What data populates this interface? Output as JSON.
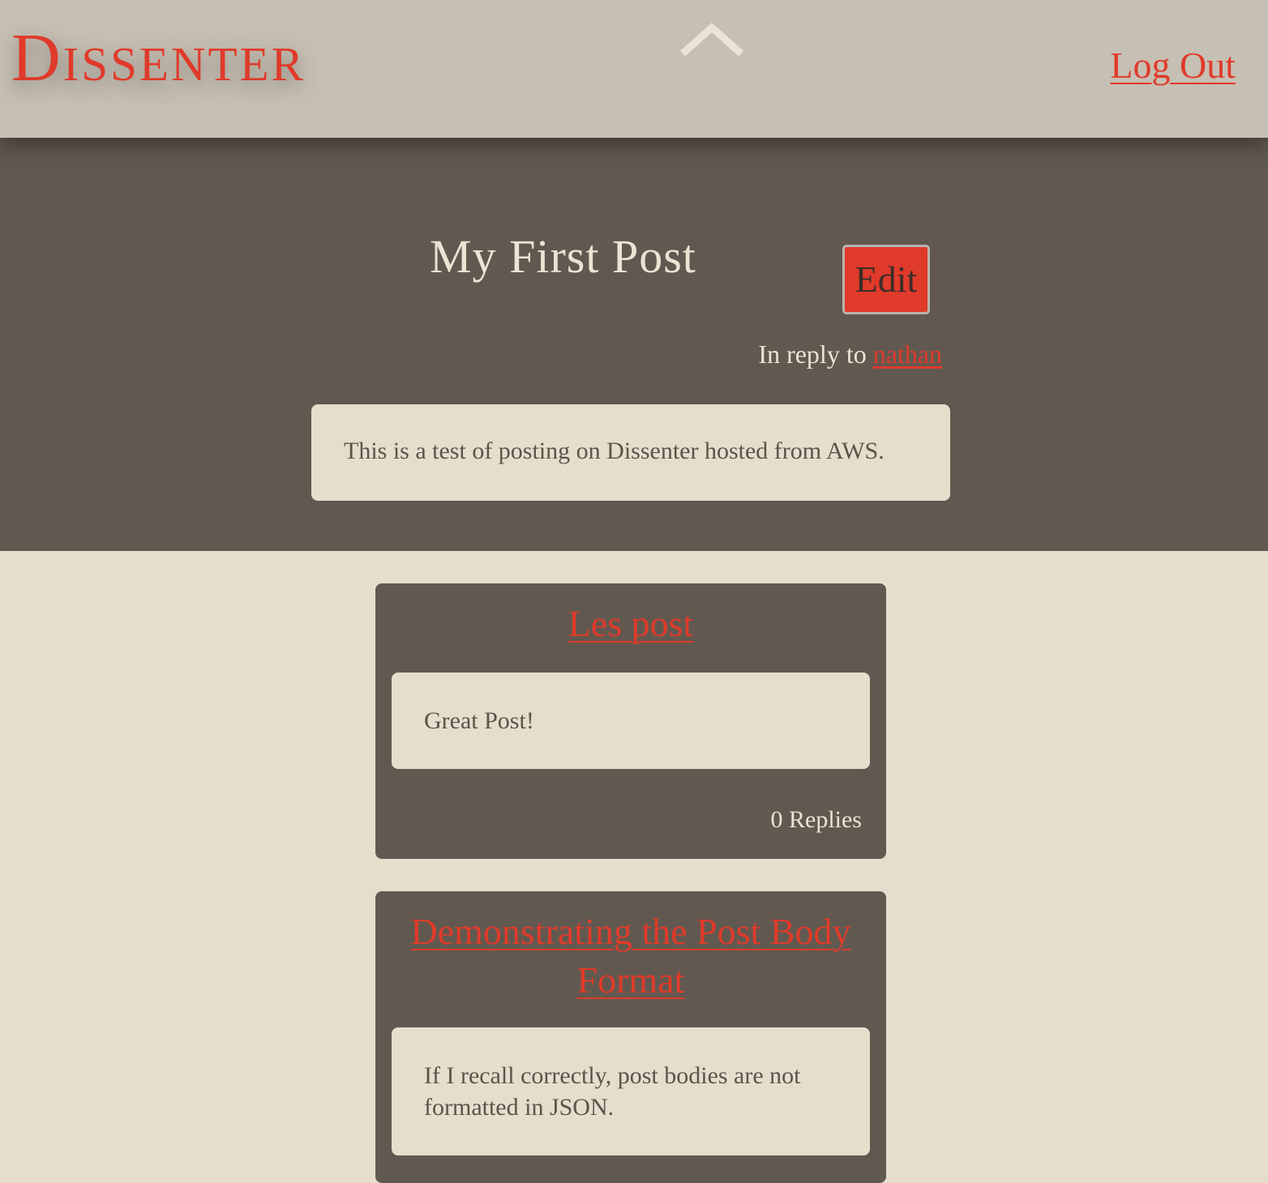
{
  "header": {
    "logo": "Dissenter",
    "collapse_icon": "chevron-up-icon",
    "logout_label": "Log Out"
  },
  "post": {
    "title": "My First Post",
    "edit_label": "Edit",
    "reply_prefix": "In reply to ",
    "reply_user": "nathan",
    "body": "This is a test of posting on Dissenter hosted from AWS."
  },
  "replies": [
    {
      "title": "Les post",
      "body": "Great Post!",
      "reply_count": "0 Replies"
    },
    {
      "title": "Demonstrating the Post Body Format",
      "body": "If I recall correctly, post bodies are not formatted in JSON."
    }
  ],
  "colors": {
    "accent": "#e03a2a",
    "header_bg": "#c6bfb3",
    "dark_bg": "#615950",
    "light_bg": "#e7ddcd",
    "light_text": "#eee3d3"
  }
}
